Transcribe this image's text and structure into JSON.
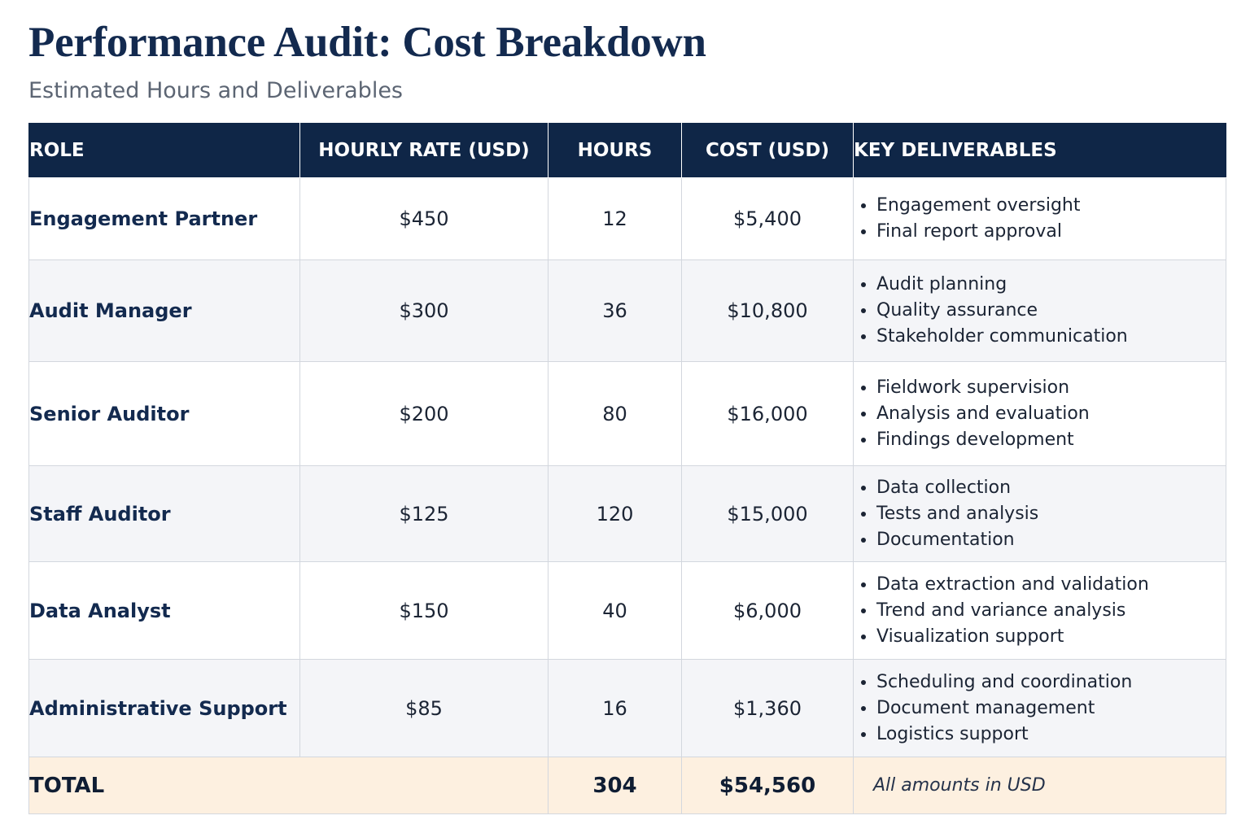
{
  "header": {
    "title": "Performance Audit: Cost Breakdown",
    "subtitle": "Estimated Hours and Deliverables"
  },
  "table": {
    "columns": [
      "ROLE",
      "HOURLY RATE (USD)",
      "HOURS",
      "COST (USD)",
      "KEY DELIVERABLES"
    ],
    "rows": [
      {
        "role": "Engagement Partner",
        "rate": "$450",
        "hours": "12",
        "cost": "$5,400",
        "deliverables": [
          "Engagement oversight",
          "Final report approval"
        ]
      },
      {
        "role": "Audit Manager",
        "rate": "$300",
        "hours": "36",
        "cost": "$10,800",
        "deliverables": [
          "Audit planning",
          "Quality assurance",
          "Stakeholder communication"
        ]
      },
      {
        "role": "Senior Auditor",
        "rate": "$200",
        "hours": "80",
        "cost": "$16,000",
        "deliverables": [
          "Fieldwork supervision",
          "Analysis and evaluation",
          "Findings development"
        ]
      },
      {
        "role": "Staff Auditor",
        "rate": "$125",
        "hours": "120",
        "cost": "$15,000",
        "deliverables": [
          "Data collection",
          "Tests and analysis",
          "Documentation"
        ]
      },
      {
        "role": "Data Analyst",
        "rate": "$150",
        "hours": "40",
        "cost": "$6,000",
        "deliverables": [
          "Data extraction and validation",
          "Trend and variance analysis",
          "Visualization support"
        ]
      },
      {
        "role": "Administrative Support",
        "rate": "$85",
        "hours": "16",
        "cost": "$1,360",
        "deliverables": [
          "Scheduling and coordination",
          "Document management",
          "Logistics support"
        ]
      }
    ],
    "total": {
      "label": "TOTAL",
      "hours": "304",
      "cost": "$54,560",
      "note": "All amounts in USD"
    }
  },
  "colors": {
    "header_bg": "#0f2647",
    "title": "#132a4f",
    "alt_row_bg": "#f4f5f8",
    "total_row_bg": "#fdf0e0"
  }
}
